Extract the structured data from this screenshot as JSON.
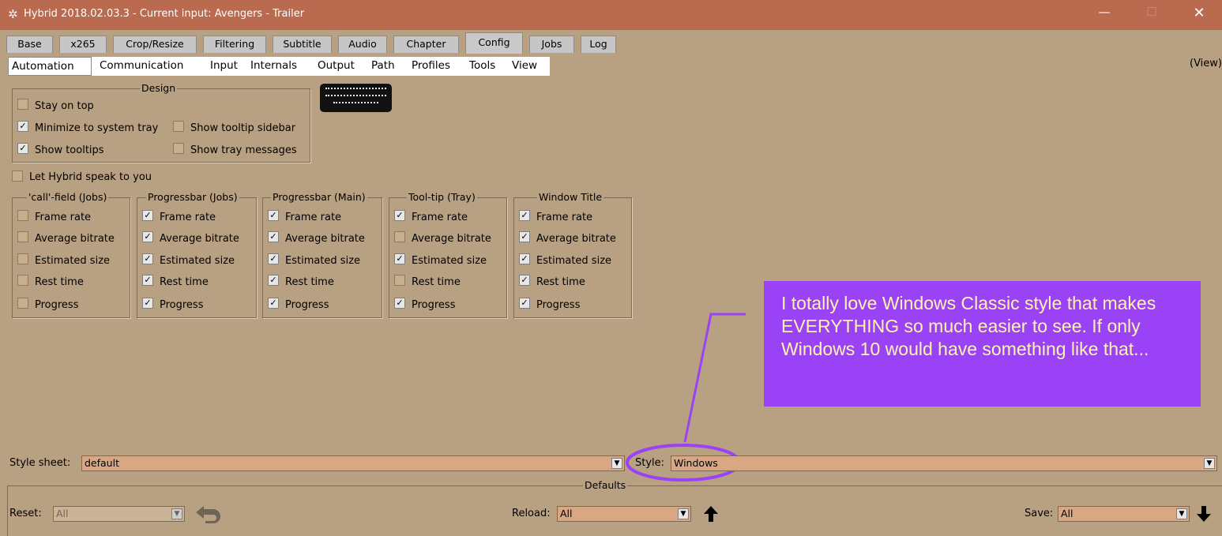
{
  "window": {
    "title": "Hybrid 2018.02.03.3 - Current input: Avengers - Trailer",
    "minimize_icon": "minimize-icon",
    "maximize_icon": "maximize-icon",
    "close_icon": "close-icon",
    "app_icon": "hybrid-app-icon"
  },
  "main_tabs": [
    {
      "label": "Base"
    },
    {
      "label": "x265"
    },
    {
      "label": "Crop/Resize"
    },
    {
      "label": "Filtering"
    },
    {
      "label": "Subtitle"
    },
    {
      "label": "Audio"
    },
    {
      "label": "Chapter"
    },
    {
      "label": "Config"
    },
    {
      "label": "Jobs"
    },
    {
      "label": "Log"
    }
  ],
  "config_tabs": [
    {
      "label": "Automation"
    },
    {
      "label": "Communication"
    },
    {
      "label": "Input"
    },
    {
      "label": "Internals"
    },
    {
      "label": "Output"
    },
    {
      "label": "Path"
    },
    {
      "label": "Profiles"
    },
    {
      "label": "Tools"
    },
    {
      "label": "View"
    }
  ],
  "view_indicator": "(View)",
  "design": {
    "legend": "Design",
    "options": [
      {
        "label": "Stay on top",
        "checked": false
      },
      {
        "label": "Minimize to system tray",
        "checked": true
      },
      {
        "label": "Show tooltip sidebar",
        "checked": false
      },
      {
        "label": "Show tooltips",
        "checked": true
      },
      {
        "label": "Show tray messages",
        "checked": false
      }
    ],
    "keyboard_icon": "keyboard-icon"
  },
  "speak_option": {
    "label": "Let Hybrid speak to you",
    "checked": false
  },
  "progress_groups": [
    {
      "legend": "'call'-field (Jobs)",
      "items": [
        {
          "label": "Frame rate",
          "checked": false
        },
        {
          "label": "Average bitrate",
          "checked": false
        },
        {
          "label": "Estimated size",
          "checked": false
        },
        {
          "label": "Rest time",
          "checked": false
        },
        {
          "label": "Progress",
          "checked": false
        }
      ]
    },
    {
      "legend": "Progressbar (Jobs)",
      "items": [
        {
          "label": "Frame rate",
          "checked": true
        },
        {
          "label": "Average bitrate",
          "checked": true
        },
        {
          "label": "Estimated size",
          "checked": true
        },
        {
          "label": "Rest time",
          "checked": true
        },
        {
          "label": "Progress",
          "checked": true
        }
      ]
    },
    {
      "legend": "Progressbar (Main)",
      "items": [
        {
          "label": "Frame rate",
          "checked": true
        },
        {
          "label": "Average bitrate",
          "checked": true
        },
        {
          "label": "Estimated size",
          "checked": true
        },
        {
          "label": "Rest time",
          "checked": true
        },
        {
          "label": "Progress",
          "checked": true
        }
      ]
    },
    {
      "legend": "Tool-tip (Tray)",
      "items": [
        {
          "label": "Frame rate",
          "checked": true
        },
        {
          "label": "Average bitrate",
          "checked": false
        },
        {
          "label": "Estimated size",
          "checked": true
        },
        {
          "label": "Rest time",
          "checked": false
        },
        {
          "label": "Progress",
          "checked": true
        }
      ]
    },
    {
      "legend": "Window Title",
      "items": [
        {
          "label": "Frame rate",
          "checked": true
        },
        {
          "label": "Average bitrate",
          "checked": true
        },
        {
          "label": "Estimated size",
          "checked": true
        },
        {
          "label": "Rest time",
          "checked": true
        },
        {
          "label": "Progress",
          "checked": true
        }
      ]
    }
  ],
  "callout": {
    "text": "I totally love Windows Classic style that makes EVERYTHING so much easier to see. If only Windows 10 would have something like that...",
    "background": "#9a42f5",
    "text_color": "#fff3b0",
    "annotation_color": "#9a42f5"
  },
  "style_sheet": {
    "label": "Style sheet:",
    "value": "default"
  },
  "style": {
    "label": "Style:",
    "value": "Windows"
  },
  "defaults": {
    "legend": "Defaults",
    "reset": {
      "label": "Reset:",
      "value": "All",
      "undo_icon": "undo-icon"
    },
    "reload": {
      "label": "Reload:",
      "value": "All",
      "up_icon": "arrow-up-icon"
    },
    "save": {
      "label": "Save:",
      "value": "All",
      "down_icon": "arrow-down-icon"
    }
  },
  "colors": {
    "window_bg": "#b8a082",
    "titlebar": "#b96a4f",
    "dropdown_bg": "#d9a783"
  }
}
